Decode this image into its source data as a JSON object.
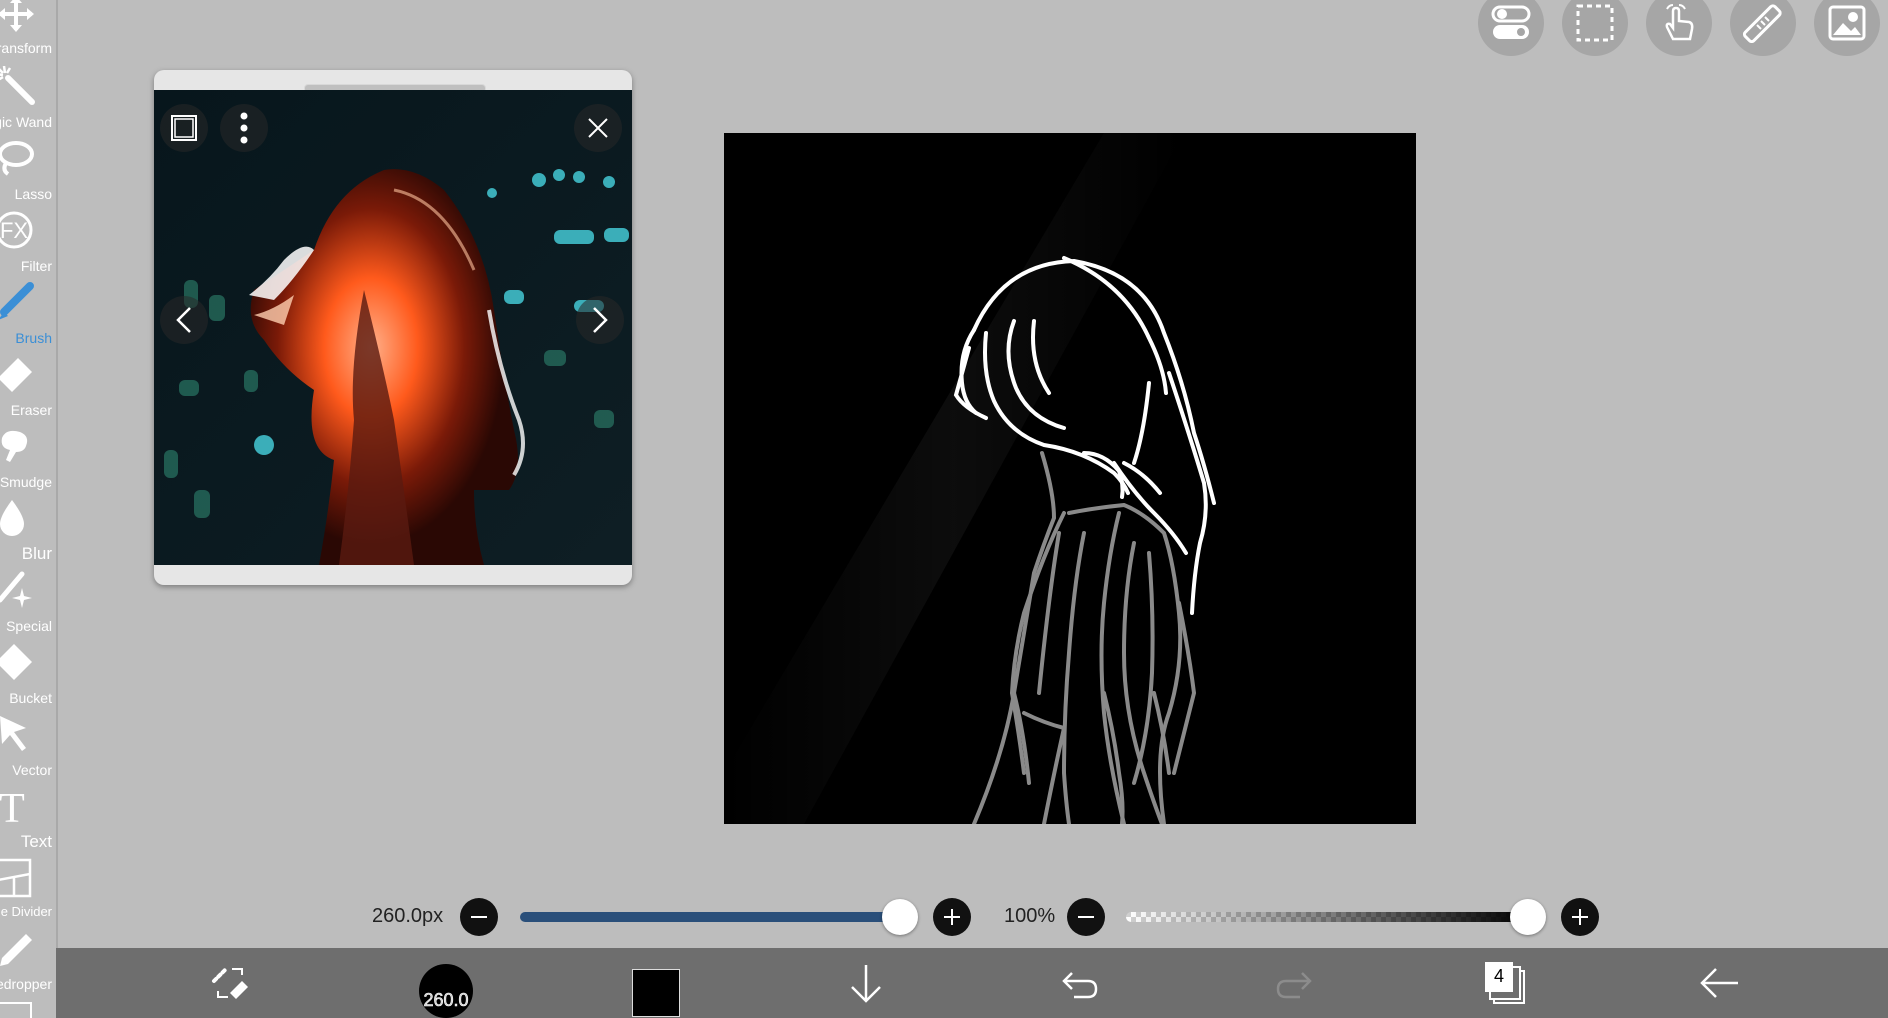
{
  "toolbar": {
    "tools": [
      {
        "name": "transform",
        "label": "Transform",
        "icon": "move-arrows-icon"
      },
      {
        "name": "magic-wand",
        "label": "Magic Wand",
        "icon": "magic-wand-icon"
      },
      {
        "name": "lasso",
        "label": "Lasso",
        "icon": "lasso-icon"
      },
      {
        "name": "filter",
        "label": "Filter",
        "icon": "fx-icon"
      },
      {
        "name": "brush",
        "label": "Brush",
        "icon": "brush-icon",
        "active": true
      },
      {
        "name": "eraser",
        "label": "Eraser",
        "icon": "eraser-icon"
      },
      {
        "name": "smudge",
        "label": "Smudge",
        "icon": "smudge-finger-icon"
      },
      {
        "name": "blur",
        "label": "Blur",
        "icon": "drop-icon"
      },
      {
        "name": "special",
        "label": "Special",
        "icon": "sparkle-wand-icon"
      },
      {
        "name": "bucket",
        "label": "Bucket",
        "icon": "bucket-diamond-icon"
      },
      {
        "name": "vector",
        "label": "Vector",
        "icon": "cursor-arrow-icon"
      },
      {
        "name": "text",
        "label": "Text",
        "icon": "text-t-icon"
      },
      {
        "name": "frame-divider",
        "label": "Frame Divider",
        "icon": "frame-divider-icon"
      },
      {
        "name": "eyedropper",
        "label": "Eyedropper",
        "icon": "eyedropper-icon"
      }
    ]
  },
  "top_buttons": [
    "toggle-settings-icon",
    "selection-icon",
    "hand-gesture-icon",
    "ruler-icon",
    "image-reference-icon"
  ],
  "reference_window": {
    "icons": [
      "square-frame-icon",
      "more-vertical-icon",
      "close-icon",
      "chevron-left-icon",
      "chevron-right-icon"
    ]
  },
  "brush_size": {
    "value_text": "260.0px",
    "level": 1.0
  },
  "opacity": {
    "value_text": "100%",
    "level": 1.0
  },
  "bottom_bar": {
    "brush_preview_label": "260.0",
    "layer_count": "4",
    "primary_color": "#000000",
    "icons": [
      "swap-brush-eraser-icon",
      "brush-preview-icon",
      "color-swatch-icon",
      "download-arrow-icon",
      "undo-icon",
      "redo-icon",
      "layers-icon",
      "back-arrow-icon"
    ]
  },
  "colors": {
    "accent": "#3b8fd6",
    "slider_fill": "#2a4f7a",
    "background": "#bdbdbd",
    "bottom_bar": "#6e6e6e"
  }
}
